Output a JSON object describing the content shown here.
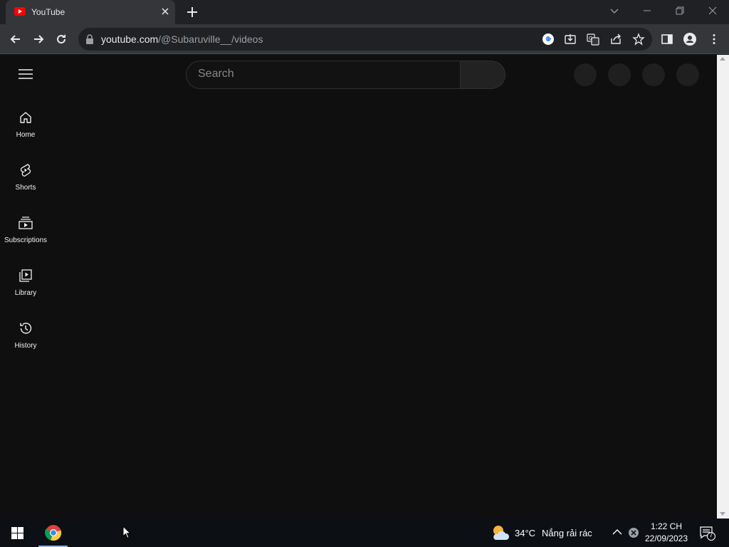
{
  "browser": {
    "tab_title": "YouTube",
    "url_host": "youtube.com",
    "url_path": "/@Subaruville__/videos"
  },
  "youtube": {
    "search_placeholder": "Search",
    "nav": [
      {
        "label": "Home",
        "icon": "home-icon"
      },
      {
        "label": "Shorts",
        "icon": "shorts-icon"
      },
      {
        "label": "Subscriptions",
        "icon": "subscriptions-icon"
      },
      {
        "label": "Library",
        "icon": "library-icon"
      },
      {
        "label": "History",
        "icon": "history-icon"
      }
    ]
  },
  "taskbar": {
    "temperature": "34°C",
    "weather_desc": "Nắng rải rác",
    "time": "1:22 CH",
    "date": "22/09/2023",
    "notification_count": "7"
  },
  "colors": {
    "page_bg": "#0f0f0f",
    "chrome_toolbar": "#35363a",
    "chrome_titlebar": "#202124",
    "youtube_red": "#ff0000"
  }
}
